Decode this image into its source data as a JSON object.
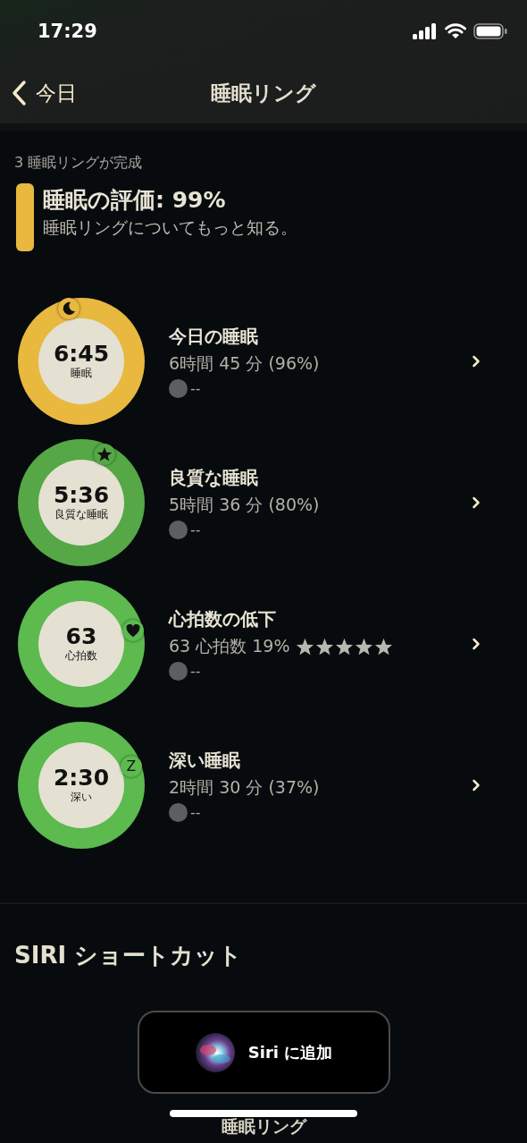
{
  "status_bar": {
    "time": "17:29"
  },
  "nav": {
    "back": "今日",
    "title": "睡眠リング"
  },
  "summary": {
    "caption": "3 睡眠リングが完成",
    "title": "睡眠の評価: 99%",
    "link": "睡眠リングについてもっと知る。",
    "color": "#e8b83f"
  },
  "rings": [
    {
      "value": "6:45",
      "unit": "睡眠",
      "title": "今日の睡眠",
      "detail": "6時間 45 分 (96%)",
      "status": "--",
      "color": "#e8b83f",
      "badge": {
        "kind": "moon"
      }
    },
    {
      "value": "5:36",
      "unit": "良質な睡眠",
      "title": "良質な睡眠",
      "detail": "5時間 36 分 (80%)",
      "status": "--",
      "color": "#55a845",
      "badge": {
        "kind": "star"
      }
    },
    {
      "value": "63",
      "unit": "心拍数",
      "title": "心拍数の低下",
      "detail": "63 心拍数 19%",
      "stars": 5,
      "status": "--",
      "color": "#5cba4f",
      "badge": {
        "kind": "heart"
      }
    },
    {
      "value": "2:30",
      "unit": "深い",
      "title": "深い睡眠",
      "detail": "2時間 30 分 (37%)",
      "status": "--",
      "color": "#5cba4f",
      "badge": {
        "kind": "letter",
        "text": "Z"
      }
    }
  ],
  "siri": {
    "heading": "SIRI ショートカット",
    "button": "Siri に追加"
  },
  "footer": {
    "title": "睡眠リング"
  }
}
